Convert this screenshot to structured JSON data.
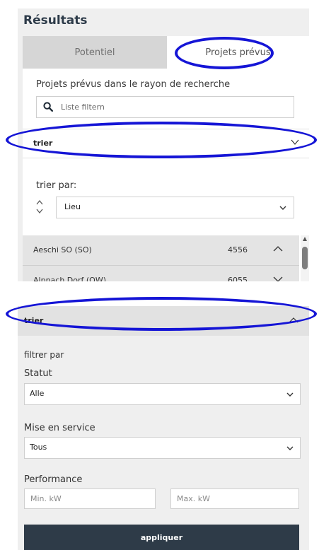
{
  "panel": {
    "title": "Résultats",
    "tabs": [
      {
        "label": "Potentiel",
        "active": false
      },
      {
        "label": "Projets prévus",
        "active": true
      }
    ],
    "subtitle": "Projets prévus dans le rayon de recherche",
    "search": {
      "placeholder": "Liste filtern",
      "value": ""
    },
    "sort_section": {
      "label": "trier",
      "expanded": false
    },
    "sort_by": {
      "label": "trier par:",
      "selected": "Lieu"
    },
    "list": [
      {
        "place": "Aeschi SO (SO)",
        "zip": "4556"
      },
      {
        "place": "Alpnach Dorf (OW)",
        "zip": "6055"
      }
    ]
  },
  "filter_panel": {
    "header": {
      "label": "trier",
      "expanded": true
    },
    "filter_by": "filtrer par",
    "status": {
      "label": "Statut",
      "selected": "Alle"
    },
    "commissioning": {
      "label": "Mise en service",
      "selected": "Tous"
    },
    "performance": {
      "label": "Performance",
      "min_placeholder": "Min. kW",
      "max_placeholder": "Max. kW"
    },
    "apply_label": "appliquer"
  },
  "colors": {
    "annotation": "#1515d6",
    "button": "#2e3b48",
    "panel_bg": "#efefef"
  },
  "icons": [
    "search-icon",
    "chevron-down-icon",
    "chevron-up-icon",
    "sort-updown-icon",
    "scroll-up-arrow-icon"
  ]
}
